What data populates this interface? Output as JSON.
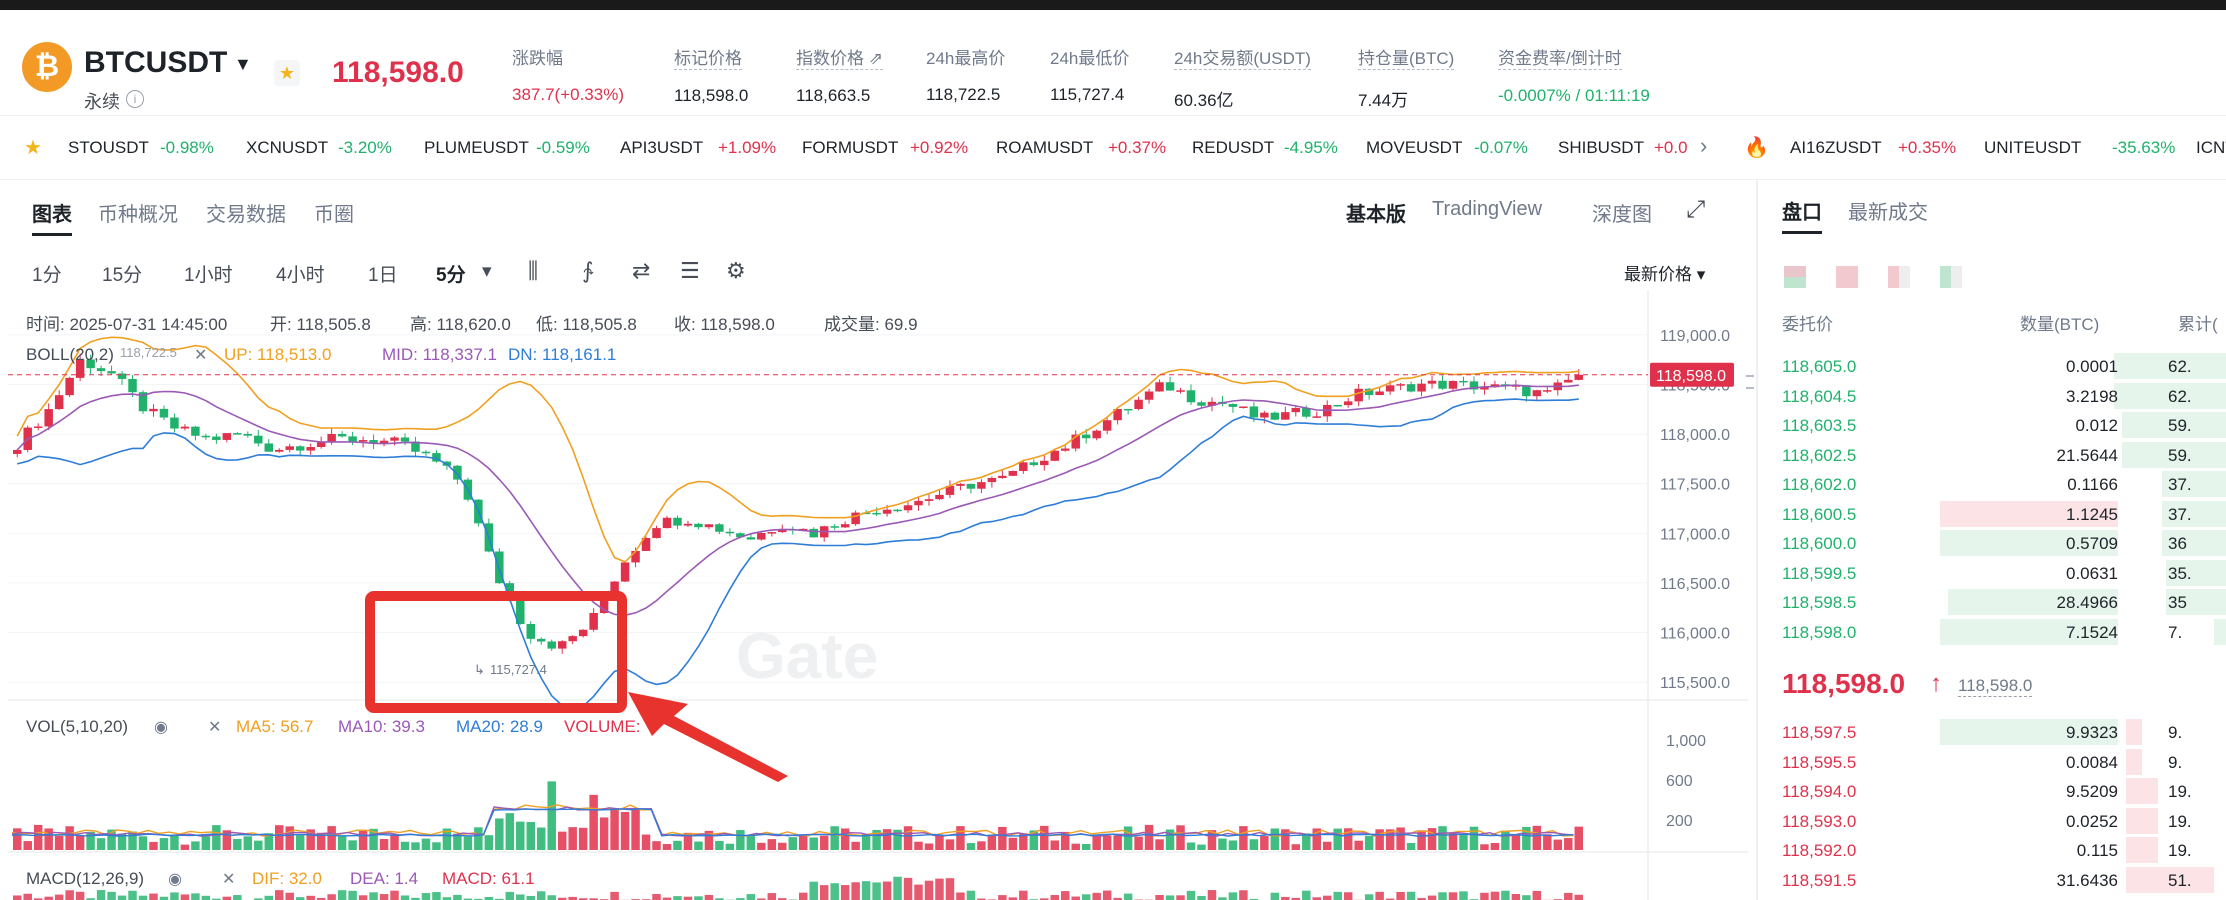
{
  "header": {
    "symbol": "BTCUSDT",
    "coin_glyph": "₿",
    "contract_type": "永续",
    "last_price": "118,598.0",
    "stats": [
      {
        "label": "涨跌幅",
        "value": "387.7(+0.33%)",
        "color": "#e0314c",
        "dashed": false
      },
      {
        "label": "标记价格",
        "value": "118,598.0",
        "color": "#1e2329",
        "dashed": true
      },
      {
        "label": "指数价格 ⇗",
        "value": "118,663.5",
        "color": "#1e2329",
        "dashed": true
      },
      {
        "label": "24h最高价",
        "value": "118,722.5",
        "color": "#1e2329",
        "dashed": false
      },
      {
        "label": "24h最低价",
        "value": "115,727.4",
        "color": "#1e2329",
        "dashed": false
      },
      {
        "label": "24h交易额(USDT)",
        "value": "60.36亿",
        "color": "#1e2329",
        "dashed": true
      },
      {
        "label": "持仓量(BTC)",
        "value": "7.44万",
        "color": "#1e2329",
        "dashed": true
      },
      {
        "label": "资金费率/倒计时",
        "value": "-0.0007% / 01:11:19",
        "color": "#20b26c",
        "dashed": true
      }
    ]
  },
  "ticker": [
    {
      "symbol": "STOUSDT",
      "change": "-0.98%",
      "up": false
    },
    {
      "symbol": "XCNUSDT",
      "change": "-3.20%",
      "up": false
    },
    {
      "symbol": "PLUMEUSDT",
      "change": "-0.59%",
      "up": false
    },
    {
      "symbol": "API3USDT",
      "change": "+1.09%",
      "up": true
    },
    {
      "symbol": "FORMUSDT",
      "change": "+0.92%",
      "up": true
    },
    {
      "symbol": "ROAMUSDT",
      "change": "+0.37%",
      "up": true
    },
    {
      "symbol": "REDUSDT",
      "change": "-4.95%",
      "up": false
    },
    {
      "symbol": "MOVEUSDT",
      "change": "-0.07%",
      "up": false
    },
    {
      "symbol": "SHIBUSDT",
      "change": "+0.0",
      "up": true
    },
    {
      "symbol": "AI16ZUSDT",
      "change": "+0.35%",
      "up": true
    },
    {
      "symbol": "UNITEUSDT",
      "change": "-35.63%",
      "up": false
    },
    {
      "symbol": "ICNT",
      "change": "",
      "up": true
    }
  ],
  "chart_tabs": [
    "图表",
    "币种概况",
    "交易数据",
    "币圈"
  ],
  "view_tabs": [
    "基本版",
    "TradingView",
    "深度图"
  ],
  "intervals": [
    "1分",
    "15分",
    "1小时",
    "4小时",
    "1日",
    "5分"
  ],
  "price_mode": "最新价格 ▾",
  "ohlc": {
    "time": "时间: 2025-07-31 14:45:00",
    "open": "开: 118,505.8",
    "high": "高: 118,620.0",
    "low": "低: 118,505.8",
    "close": "收: 118,598.0",
    "vol": "成交量: 69.9"
  },
  "boll": {
    "name": "BOLL(20,2)",
    "up": "UP: 118,513.0",
    "mid": "MID: 118,337.1",
    "dn": "DN: 118,161.1",
    "overlap": "118,722.5"
  },
  "vol_legend": {
    "name": "VOL(5,10,20)",
    "ma5": "MA5: 56.7",
    "ma10": "MA10: 39.3",
    "ma20": "MA20: 28.9",
    "volume": "VOLUME:"
  },
  "macd_legend": {
    "name": "MACD(12,26,9)",
    "dif": "DIF: 32.0",
    "dea": "DEA: 1.4",
    "macd": "MACD: 61.1"
  },
  "low_marker": "115,727.4",
  "watermark": "Gate",
  "current_price_tag": "118,598.0",
  "colors": {
    "up": "#e0314c",
    "down": "#20b26c",
    "boll_up": "#f0a020",
    "boll_mid": "#9b59b6",
    "boll_dn": "#2e7dd7",
    "highlight": "#e8322e"
  },
  "chart_data": {
    "type": "candlestick",
    "interval": "5分",
    "y_axis_ticks": [
      "119,000.0",
      "118,500.0",
      "118,000.0",
      "117,500.0",
      "117,000.0",
      "116,500.0",
      "116,000.0",
      "115,500.0"
    ],
    "ylim": [
      115300,
      119150
    ],
    "volume_ticks": [
      "1,000",
      "600",
      "200"
    ],
    "low_point": 115727.4,
    "last": 118598.0,
    "trend_closes": [
      117900,
      118250,
      118750,
      118600,
      118250,
      118050,
      117950,
      118000,
      117850,
      117900,
      117950,
      117950,
      117900,
      117750,
      117500,
      116600,
      116000,
      115850,
      116100,
      116700,
      117100,
      117150,
      117050,
      116950,
      117100,
      117000,
      117150,
      117250,
      117300,
      117400,
      117500,
      117550,
      117750,
      117900,
      118100,
      118300,
      118500,
      118350,
      118300,
      118150,
      118200,
      118250,
      118400,
      118450,
      118500,
      118500,
      118480,
      118450,
      118400,
      118600
    ]
  },
  "orderbook": {
    "tabs": [
      "盘口",
      "最新成交"
    ],
    "headers": [
      "委托价",
      "数量(BTC)",
      "累计("
    ],
    "asks_top": [
      {
        "price": "118,605.0",
        "amount": "0.0001",
        "total": "62."
      },
      {
        "price": "118,604.5",
        "amount": "3.2198",
        "total": "62."
      },
      {
        "price": "118,603.5",
        "amount": "0.012",
        "total": "59."
      },
      {
        "price": "118,602.5",
        "amount": "21.5644",
        "total": "59."
      },
      {
        "price": "118,602.0",
        "amount": "0.1166",
        "total": "37."
      },
      {
        "price": "118,600.5",
        "amount": "1.1245",
        "total": "37."
      },
      {
        "price": "118,600.0",
        "amount": "0.5709",
        "total": "36"
      },
      {
        "price": "118,599.5",
        "amount": "0.0631",
        "total": "35."
      },
      {
        "price": "118,598.5",
        "amount": "28.4966",
        "total": "35"
      },
      {
        "price": "118,598.0",
        "amount": "7.1524",
        "total": "7."
      }
    ],
    "mid_price": "118,598.0",
    "mid_arrow": "↑",
    "mid_mark": "118,598.0",
    "bids": [
      {
        "price": "118,597.5",
        "amount": "9.9323",
        "total": "9."
      },
      {
        "price": "118,595.5",
        "amount": "0.0084",
        "total": "9."
      },
      {
        "price": "118,594.0",
        "amount": "9.5209",
        "total": "19."
      },
      {
        "price": "118,593.0",
        "amount": "0.0252",
        "total": "19."
      },
      {
        "price": "118,592.0",
        "amount": "0.115",
        "total": "19."
      },
      {
        "price": "118,591.5",
        "amount": "31.6436",
        "total": "51."
      }
    ],
    "total_fill": {
      "asks": [
        0.28,
        0.28,
        0.26,
        0.26,
        0.16,
        0.16,
        0.16,
        0.15,
        0.15,
        0.03
      ],
      "bids": [
        0.04,
        0.04,
        0.08,
        0.08,
        0.08,
        0.22
      ]
    }
  }
}
